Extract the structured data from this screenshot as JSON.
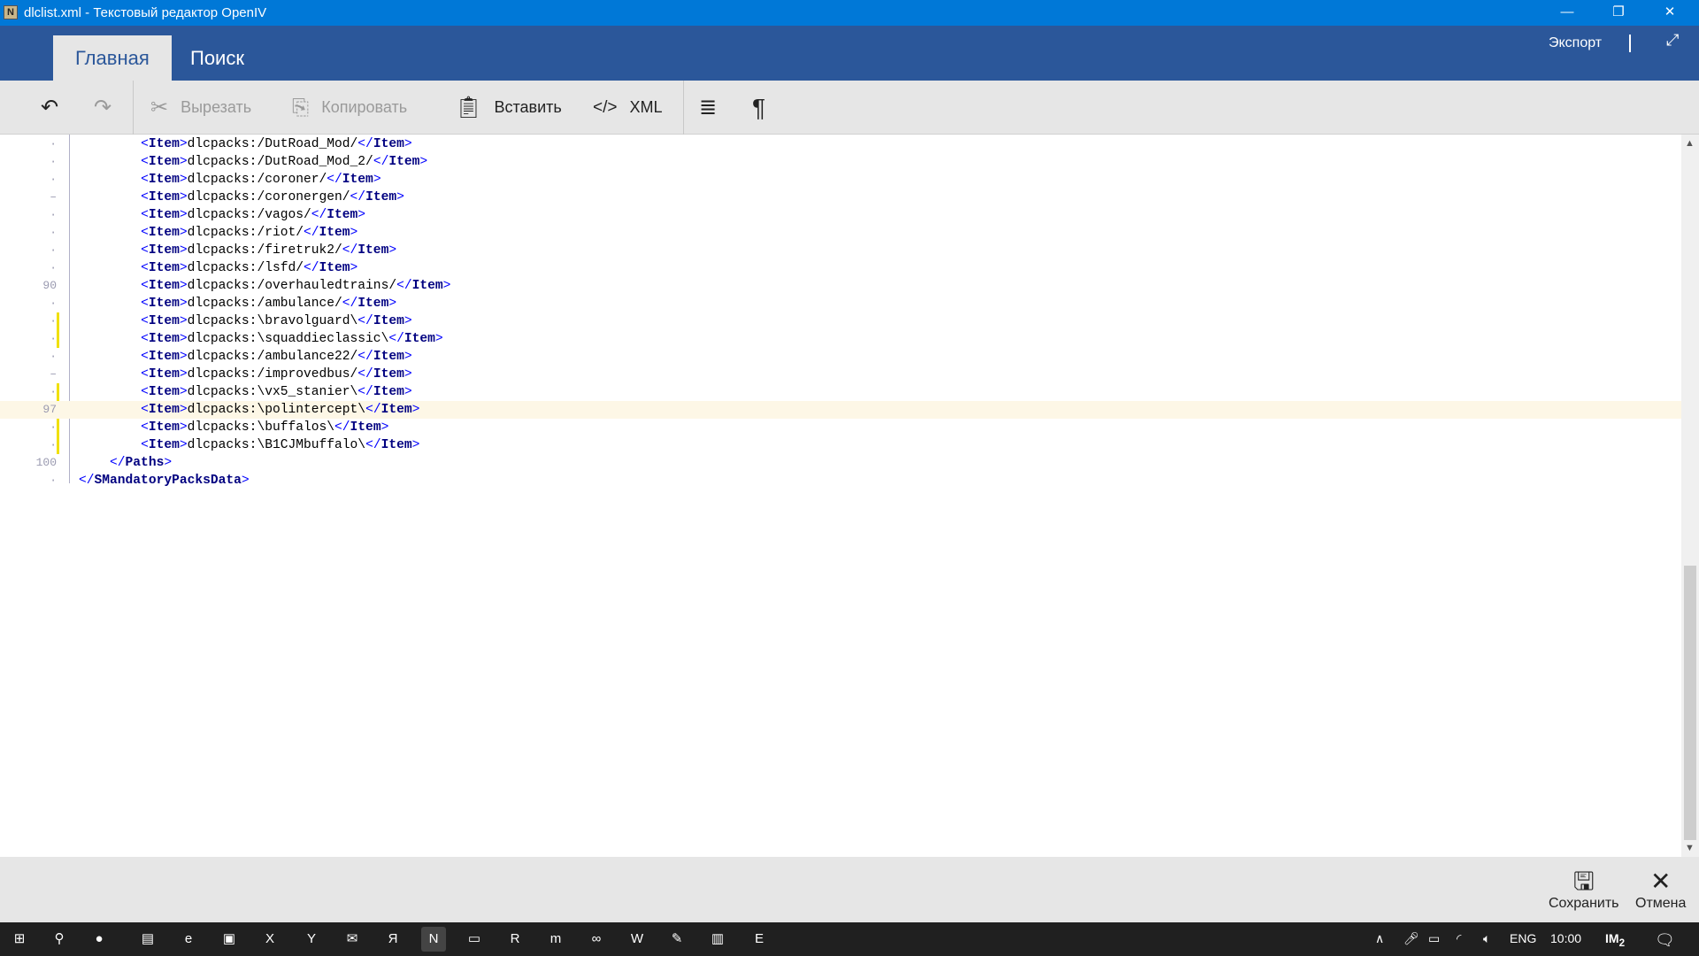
{
  "window": {
    "title": "dlclist.xml - Текстовый редактор OpenIV",
    "app_icon": "N"
  },
  "ribbon": {
    "tabs": [
      {
        "label": "Главная",
        "active": true
      },
      {
        "label": "Поиск",
        "active": false
      }
    ],
    "export_label": "Экспорт"
  },
  "toolbar": {
    "undo": "undo-icon",
    "redo": "redo-icon",
    "cut": "Вырезать",
    "copy": "Копировать",
    "paste": "Вставить",
    "xml": "XML",
    "wrap": "word-wrap-icon",
    "pilcrow": "¶"
  },
  "editor": {
    "lines": [
      {
        "num": "·",
        "indent": 8,
        "value": "dlcpacks:/DutRoad_Mod/",
        "tag": "Item"
      },
      {
        "num": "·",
        "indent": 8,
        "value": "dlcpacks:/DutRoad_Mod_2/",
        "tag": "Item"
      },
      {
        "num": "·",
        "indent": 8,
        "value": "dlcpacks:/coroner/",
        "tag": "Item"
      },
      {
        "num": "–",
        "indent": 8,
        "value": "dlcpacks:/coronergen/",
        "tag": "Item"
      },
      {
        "num": "·",
        "indent": 8,
        "value": "dlcpacks:/vagos/",
        "tag": "Item"
      },
      {
        "num": "·",
        "indent": 8,
        "value": "dlcpacks:/riot/",
        "tag": "Item"
      },
      {
        "num": "·",
        "indent": 8,
        "value": "dlcpacks:/firetruk2/",
        "tag": "Item"
      },
      {
        "num": "·",
        "indent": 8,
        "value": "dlcpacks:/lsfd/",
        "tag": "Item"
      },
      {
        "num": "90",
        "indent": 8,
        "value": "dlcpacks:/overhauledtrains/",
        "tag": "Item"
      },
      {
        "num": "·",
        "indent": 8,
        "value": "dlcpacks:/ambulance/",
        "tag": "Item"
      },
      {
        "num": "·",
        "indent": 8,
        "value": "dlcpacks:\\bravolguard\\",
        "tag": "Item",
        "changed": true
      },
      {
        "num": "·",
        "indent": 8,
        "value": "dlcpacks:\\squaddieclassic\\",
        "tag": "Item",
        "changed": true
      },
      {
        "num": "·",
        "indent": 8,
        "value": "dlcpacks:/ambulance22/",
        "tag": "Item"
      },
      {
        "num": "–",
        "indent": 8,
        "value": "dlcpacks:/improvedbus/",
        "tag": "Item"
      },
      {
        "num": "·",
        "indent": 8,
        "value": "dlcpacks:\\vx5_stanier\\",
        "tag": "Item",
        "changed": true
      },
      {
        "num": "97",
        "indent": 8,
        "value": "dlcpacks:\\polintercept\\",
        "tag": "Item",
        "current": true
      },
      {
        "num": "·",
        "indent": 8,
        "value": "dlcpacks:\\buffalos\\",
        "tag": "Item",
        "changed": true
      },
      {
        "num": "·",
        "indent": 8,
        "value": "dlcpacks:\\B1CJMbuffalo\\",
        "tag": "Item",
        "changed": true
      },
      {
        "num": "100",
        "indent": 4,
        "close": "Paths"
      },
      {
        "num": "·",
        "indent": 0,
        "close": "SMandatoryPacksData"
      }
    ]
  },
  "bottom": {
    "save": "Сохранить",
    "cancel": "Отмена"
  },
  "taskbar": {
    "apps": [
      "windows-start",
      "search",
      "cortana",
      "file-explorer",
      "edge",
      "store",
      "excel",
      "yandex-browser",
      "mail",
      "yandex",
      "openiv",
      "monitor",
      "rockstar",
      "maxthon",
      "visual-studio",
      "word",
      "paint",
      "notepad",
      "epic-games"
    ],
    "active_index": 10,
    "tray": {
      "lang": "ENG",
      "time": "10:00",
      "badge": "2"
    }
  }
}
